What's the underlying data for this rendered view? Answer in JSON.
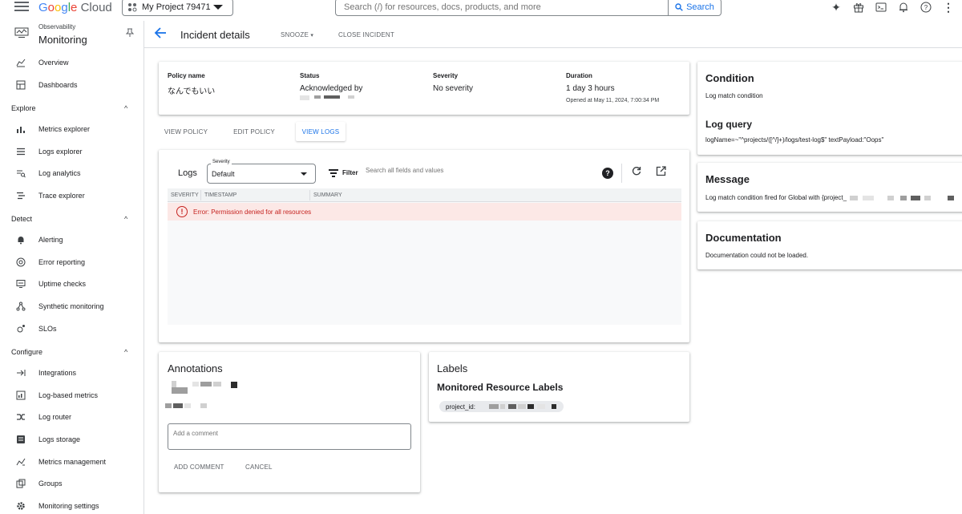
{
  "topbar": {
    "brand": "Google Cloud",
    "project": "My Project 79471",
    "search_placeholder": "Search (/) for resources, docs, products, and more",
    "search_button": "Search"
  },
  "sidebar": {
    "subtitle": "Observability",
    "title": "Monitoring",
    "items": [
      {
        "label": "Overview"
      },
      {
        "label": "Dashboards"
      }
    ],
    "sections": [
      {
        "label": "Explore",
        "items": [
          {
            "label": "Metrics explorer"
          },
          {
            "label": "Logs explorer"
          },
          {
            "label": "Log analytics"
          },
          {
            "label": "Trace explorer"
          }
        ]
      },
      {
        "label": "Detect",
        "items": [
          {
            "label": "Alerting"
          },
          {
            "label": "Error reporting"
          },
          {
            "label": "Uptime checks"
          },
          {
            "label": "Synthetic monitoring"
          },
          {
            "label": "SLOs"
          }
        ]
      },
      {
        "label": "Configure",
        "items": [
          {
            "label": "Integrations"
          },
          {
            "label": "Log-based metrics"
          },
          {
            "label": "Log router"
          },
          {
            "label": "Logs storage"
          },
          {
            "label": "Metrics management"
          },
          {
            "label": "Groups"
          },
          {
            "label": "Monitoring settings"
          }
        ]
      }
    ]
  },
  "header": {
    "title": "Incident details",
    "snooze": "SNOOZE",
    "close": "CLOSE INCIDENT"
  },
  "summary": {
    "policy_label": "Policy name",
    "policy_value": "なんでもいい",
    "status_label": "Status",
    "status_value": "Acknowledged by",
    "severity_label": "Severity",
    "severity_value": "No severity",
    "duration_label": "Duration",
    "duration_value": "1 day 3 hours",
    "opened": "Opened at May 11, 2024, 7:00:34 PM"
  },
  "tabs": [
    "VIEW POLICY",
    "EDIT POLICY",
    "VIEW LOGS"
  ],
  "logs": {
    "title": "Logs",
    "severity_legend": "Severity",
    "severity_value": "Default",
    "filter_label": "Filter",
    "filter_placeholder": "Search all fields and values",
    "columns": [
      "SEVERITY",
      "TIMESTAMP",
      "SUMMARY"
    ],
    "error": "Error: Permission denied for all resources"
  },
  "annotations": {
    "title": "Annotations",
    "comment_placeholder": "Add a comment",
    "add_button": "ADD COMMENT",
    "cancel_button": "CANCEL"
  },
  "labels": {
    "title": "Labels",
    "subtitle": "Monitored Resource Labels",
    "chip": "project_id:"
  },
  "condition": {
    "title": "Condition",
    "text": "Log match condition",
    "log_query_title": "Log query",
    "log_query": "logName=~\"^projects/([^/]+)/logs/test-log$\" textPayload:\"Oops\""
  },
  "message": {
    "title": "Message",
    "text": "Log match condition fired for Global with {project_"
  },
  "documentation": {
    "title": "Documentation",
    "text": "Documentation could not be loaded."
  }
}
